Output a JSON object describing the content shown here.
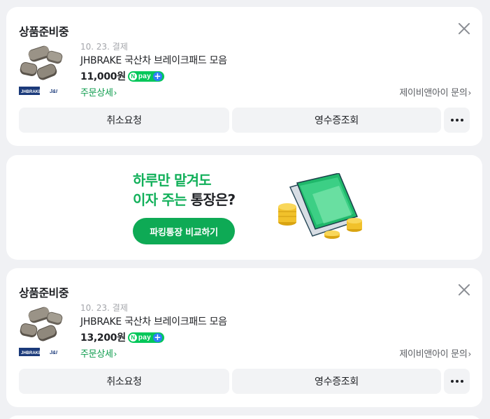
{
  "orders": [
    {
      "status": "상품준비중",
      "date": "10. 23. 결제",
      "product": "JHBRAKE 국산차 브레이크패드 모음",
      "price": "11,000원",
      "detail_link": "주문상세",
      "seller_link": "제이비앤아이 문의",
      "cancel_label": "취소요청",
      "receipt_label": "영수증조회"
    },
    {
      "status": "상품준비중",
      "date": "10. 23. 결제",
      "product": "JHBRAKE 국산차 브레이크패드 모음",
      "price": "13,200원",
      "detail_link": "주문상세",
      "seller_link": "제이비앤아이 문의",
      "cancel_label": "취소요청",
      "receipt_label": "영수증조회"
    }
  ],
  "npay": {
    "n": "N",
    "pay": "pay",
    "plus": "+"
  },
  "banner": {
    "line1": "하루만 맡겨도",
    "line2_green": "이자 주는",
    "line2_dark": "통장은?",
    "cta": "파킹통장 비교하기"
  },
  "thumb_brand": {
    "left": "JHBRAKE",
    "right": "J&I"
  },
  "colors": {
    "accent_green": "#03c75a",
    "link_green": "#0b9b4b",
    "npay_plus_blue": "#2e7cf6",
    "button_bg": "#f2f3f5"
  },
  "icons": [
    "close-icon",
    "chevron-right-icon",
    "more-dots-icon",
    "npay-badge-icon"
  ]
}
